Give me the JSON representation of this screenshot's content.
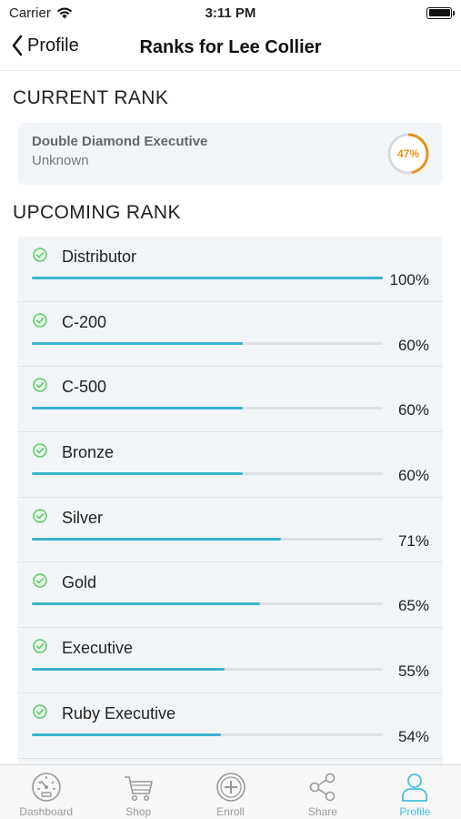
{
  "status_bar": {
    "carrier": "Carrier",
    "time": "3:11 PM"
  },
  "nav": {
    "back_label": "Profile",
    "title": "Ranks for Lee Collier"
  },
  "current_rank": {
    "section_title": "CURRENT RANK",
    "name": "Double Diamond Executive",
    "subtitle": "Unknown",
    "progress_label": "47%",
    "progress_fraction": 0.47
  },
  "upcoming_rank": {
    "section_title": "UPCOMING RANK",
    "items": [
      {
        "name": "Distributor",
        "pct_label": "100%",
        "fraction": 1.0
      },
      {
        "name": "C-200",
        "pct_label": "60%",
        "fraction": 0.6
      },
      {
        "name": "C-500",
        "pct_label": "60%",
        "fraction": 0.6
      },
      {
        "name": "Bronze",
        "pct_label": "60%",
        "fraction": 0.6
      },
      {
        "name": "Silver",
        "pct_label": "71%",
        "fraction": 0.71
      },
      {
        "name": "Gold",
        "pct_label": "65%",
        "fraction": 0.65
      },
      {
        "name": "Executive",
        "pct_label": "55%",
        "fraction": 0.55
      },
      {
        "name": "Ruby Executive",
        "pct_label": "54%",
        "fraction": 0.54
      }
    ]
  },
  "tab_bar": {
    "tabs": [
      {
        "label": "Dashboard",
        "icon": "dashboard-gauge-icon",
        "active": false
      },
      {
        "label": "Shop",
        "icon": "shopping-cart-icon",
        "active": false
      },
      {
        "label": "Enroll",
        "icon": "add-circle-icon",
        "active": false
      },
      {
        "label": "Share",
        "icon": "share-icon",
        "active": false
      },
      {
        "label": "Profile",
        "icon": "user-profile-icon",
        "active": true
      }
    ]
  },
  "colors": {
    "accent": "#47bfe0",
    "progress_bar": "#3ab4d0",
    "ring": "#e6941a",
    "check": "#5cc96a"
  }
}
